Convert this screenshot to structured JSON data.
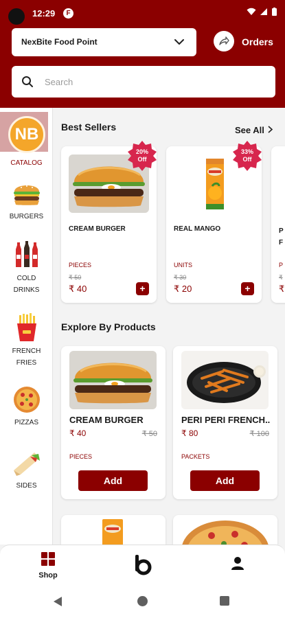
{
  "status_bar": {
    "time": "12:29",
    "app_icon": "F"
  },
  "header": {
    "store_name": "NexBite Food Point",
    "orders_label": "Orders",
    "search_placeholder": "Search"
  },
  "sidebar": {
    "catalog_badge": "NB",
    "items": [
      {
        "label": "CATALOG",
        "icon": "nb-logo-icon"
      },
      {
        "label": "BURGERS",
        "icon": "burger-icon"
      },
      {
        "label": "COLD DRINKS",
        "icon": "soda-bottles-icon"
      },
      {
        "label": "FRENCH FRIES",
        "icon": "fries-icon"
      },
      {
        "label": "PIZZAS",
        "icon": "pizza-icon"
      },
      {
        "label": "SIDES",
        "icon": "wrap-icon"
      }
    ]
  },
  "best_sellers": {
    "title": "Best Sellers",
    "see_all": "See All",
    "items": [
      {
        "name": "CREAM BURGER",
        "unit": "PIECES",
        "mrp": "₹ 50",
        "price": "₹ 40",
        "discount": "20% Off"
      },
      {
        "name": "REAL MANGO",
        "unit": "UNITS",
        "mrp": "₹ 30",
        "price": "₹ 20",
        "discount": "33% Off"
      },
      {
        "name": "P F",
        "unit": "P",
        "mrp": "₹",
        "price": "₹"
      }
    ]
  },
  "explore": {
    "title": "Explore By Products",
    "items": [
      {
        "name": "CREAM BURGER",
        "price": "₹ 40",
        "mrp": "₹ 50",
        "unit": "PIECES",
        "button": "Add"
      },
      {
        "name": "PERI PERI FRENCH...",
        "price": "₹ 80",
        "mrp": "₹ 100",
        "unit": "PACKETS",
        "button": "Add"
      }
    ]
  },
  "bottom_nav": {
    "shop_label": "Shop"
  },
  "colors": {
    "brand": "#8b0000",
    "badge": "#d7264d",
    "catalog_active_bg": "#d6a3a3"
  }
}
